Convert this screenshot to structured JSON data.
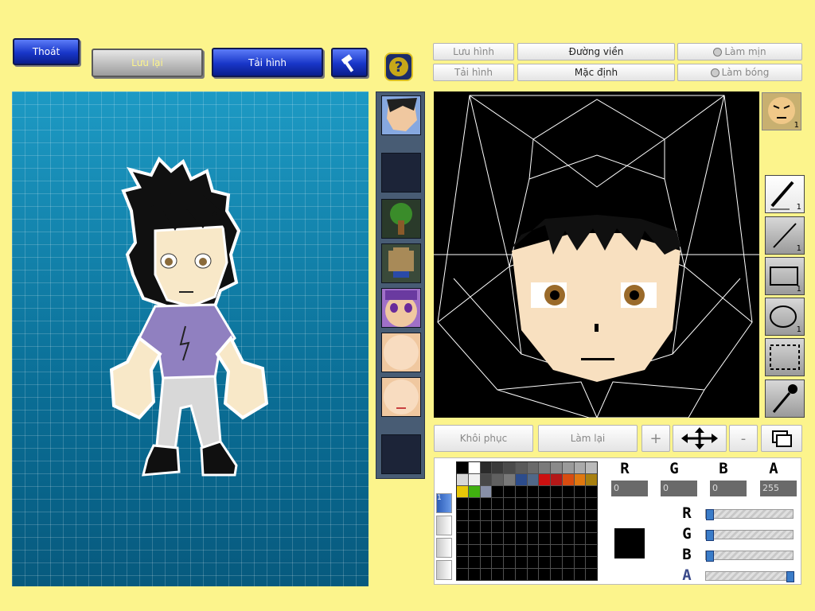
{
  "top_bar": {
    "exit_label": "Thoát",
    "save_label": "Lưu lại",
    "reload_label": "Tải hình",
    "help_icon_text": "?"
  },
  "editor_top": {
    "save_small": "Lưu hình",
    "outline": "Đường viền",
    "smooth": "Làm mịn",
    "reload_small": "Tải hình",
    "default": "Mặc định",
    "shade": "Làm bóng"
  },
  "tools": {
    "pen_count": "1",
    "line_count": "1",
    "rect_count": "1",
    "ellipse_count": "1",
    "face_badge": "1"
  },
  "editor_bottom": {
    "restore": "Khôi phục",
    "redo": "Làm lại",
    "zoom_in": "+",
    "zoom_out": "-"
  },
  "color_picker": {
    "r_label": "R",
    "g_label": "G",
    "b_label": "B",
    "a_label": "A",
    "r_value": "0",
    "g_value": "0",
    "b_value": "0",
    "a_value": "255",
    "r_level": 0,
    "g_level": 0,
    "b_level": 0,
    "a_level": 1,
    "current_color": "#000000",
    "tab_one": "1",
    "palette_colors": [
      "#000000",
      "#ffffff",
      "#2a2a2a",
      "#3a3a3a",
      "#4a4a4a",
      "#5a5a5a",
      "#6a6a6a",
      "#7a7a7a",
      "#8a8a8a",
      "#9a9a9a",
      "#aaaaaa",
      "#bababa",
      "#d8d8d8",
      "#f0f0f0",
      "#484848",
      "#606060",
      "#787878",
      "#2c4c8c",
      "#506888",
      "#cc1010",
      "#b41818",
      "#d84c10",
      "#e07810",
      "#a88010",
      "#e8c808",
      "#40b010",
      "#8890a8"
    ]
  },
  "colors": {
    "background": "#fcf48c",
    "button_blue": "#1836c8"
  }
}
